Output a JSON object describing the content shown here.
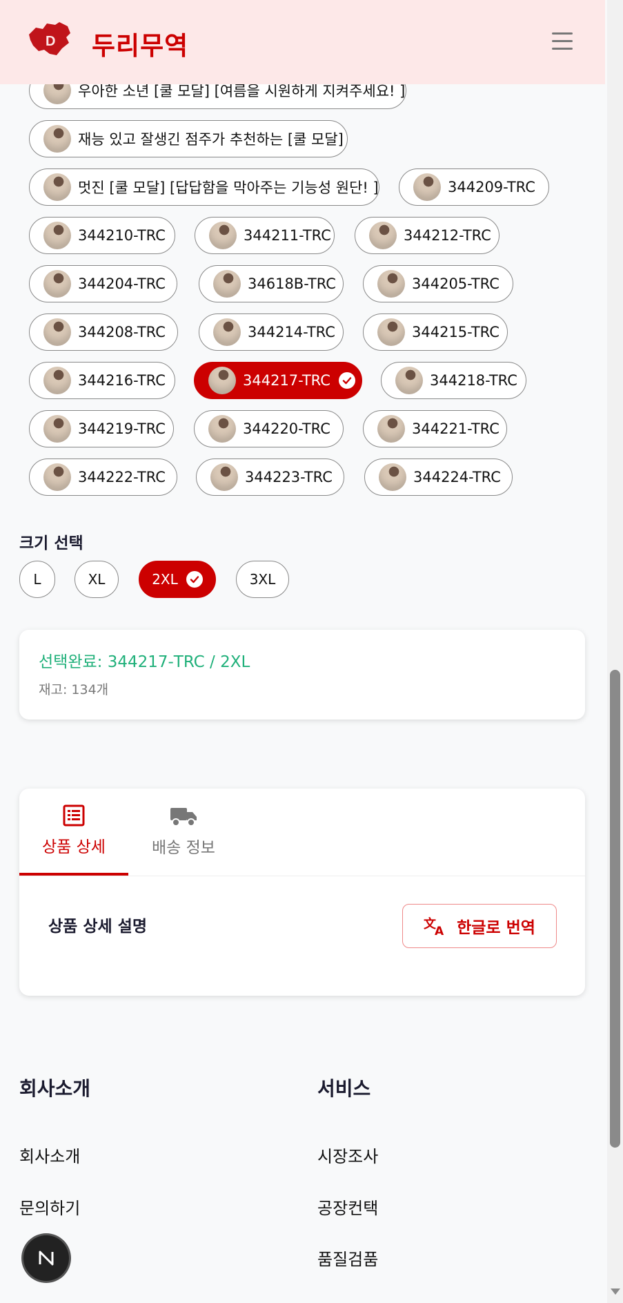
{
  "header": {
    "brand": "두리무역"
  },
  "variants": [
    {
      "label": "우아한 소년 [쿨 모달] [여름을 시원하게 지켜주세요! ]",
      "selected": false
    },
    {
      "label": "재능 있고 잘생긴 점주가 추천하는 [쿨 모달]",
      "selected": false
    },
    {
      "label": "멋진 [쿨 모달] [답답함을 막아주는 기능성 원단! ]",
      "selected": false
    },
    {
      "label": "344209-TRC",
      "selected": false
    },
    {
      "label": "344210-TRC",
      "selected": false
    },
    {
      "label": "344211-TRC",
      "selected": false
    },
    {
      "label": "344212-TRC",
      "selected": false
    },
    {
      "label": "344204-TRC",
      "selected": false
    },
    {
      "label": "34618B-TRC",
      "selected": false
    },
    {
      "label": "344205-TRC",
      "selected": false
    },
    {
      "label": "344208-TRC",
      "selected": false
    },
    {
      "label": "344214-TRC",
      "selected": false
    },
    {
      "label": "344215-TRC",
      "selected": false
    },
    {
      "label": "344216-TRC",
      "selected": false
    },
    {
      "label": "344217-TRC",
      "selected": true
    },
    {
      "label": "344218-TRC",
      "selected": false
    },
    {
      "label": "344219-TRC",
      "selected": false
    },
    {
      "label": "344220-TRC",
      "selected": false
    },
    {
      "label": "344221-TRC",
      "selected": false
    },
    {
      "label": "344222-TRC",
      "selected": false
    },
    {
      "label": "344223-TRC",
      "selected": false
    },
    {
      "label": "344224-TRC",
      "selected": false
    }
  ],
  "size": {
    "title": "크기 선택",
    "options": [
      {
        "label": "L",
        "selected": false
      },
      {
        "label": "XL",
        "selected": false
      },
      {
        "label": "2XL",
        "selected": true
      },
      {
        "label": "3XL",
        "selected": false
      }
    ]
  },
  "selection": {
    "done_text": "선택완료: 344217-TRC / 2XL",
    "stock_text": "재고: 134개"
  },
  "tabs": [
    {
      "label": "상품 상세",
      "icon": "list-alt-icon",
      "active": true
    },
    {
      "label": "배송 정보",
      "icon": "truck-icon",
      "active": false
    }
  ],
  "detail": {
    "title": "상품 상세 설명",
    "translate_label": "한글로 번역"
  },
  "footer": {
    "col1": {
      "heading": "회사소개",
      "links": [
        "회사소개",
        "문의하기"
      ]
    },
    "col2": {
      "heading": "서비스",
      "links": [
        "시장조사",
        "공장컨택",
        "품질검품"
      ]
    }
  },
  "colors": {
    "accent": "#cc0000",
    "success": "#20b07a",
    "header_bg": "#fde8e8"
  }
}
